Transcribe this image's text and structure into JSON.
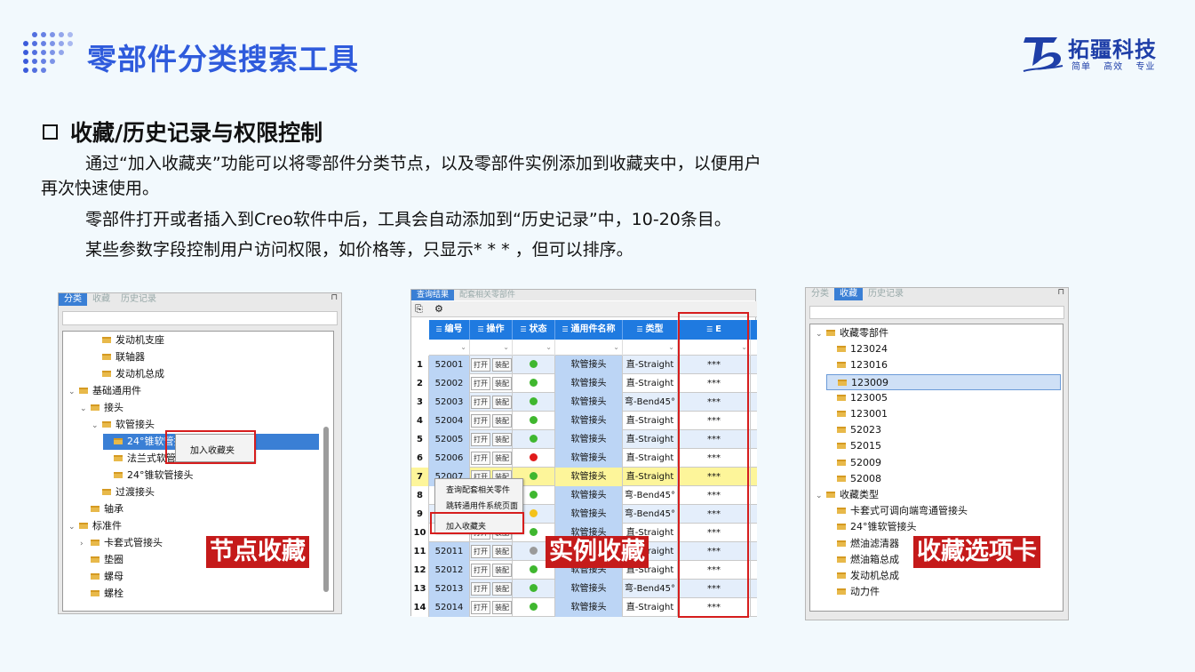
{
  "header": {
    "title": "零部件分类搜索工具",
    "logo_name": "拓疆科技",
    "logo_slogan": "简单 高效 专业"
  },
  "section": {
    "title": "收藏/历史记录与权限控制",
    "para1_line1": "通过“加入收藏夹”功能可以将零部件分类节点，以及零部件实例添加到收藏夹中，以便用户",
    "para1_line2": "再次快速使用。",
    "para2": "零部件打开或者插入到Creo软件中后，工具会自动添加到“历史记录”中，10-20条目。",
    "para3": "某些参数字段控制用户访问权限，如价格等，只显示* * * ，但可以排序。"
  },
  "panel1": {
    "tabs": [
      "分类",
      "收藏",
      "历史记录"
    ],
    "tree": [
      {
        "label": "发动机支座",
        "level": 2,
        "exp": ""
      },
      {
        "label": "联轴器",
        "level": 2,
        "exp": ""
      },
      {
        "label": "发动机总成",
        "level": 2,
        "exp": ""
      },
      {
        "label": "基础通用件",
        "level": 0,
        "exp": "v"
      },
      {
        "label": "接头",
        "level": 1,
        "exp": "v"
      },
      {
        "label": "软管接头",
        "level": 2,
        "exp": "v"
      },
      {
        "label": "24°锥软管接头",
        "level": 3,
        "exp": "",
        "selected": true
      },
      {
        "label": "法兰式软管接头",
        "level": 3,
        "exp": ""
      },
      {
        "label": "24°锥软管接头",
        "level": 3,
        "exp": ""
      },
      {
        "label": "过渡接头",
        "level": 2,
        "exp": ""
      },
      {
        "label": "轴承",
        "level": 1,
        "exp": ""
      },
      {
        "label": "标准件",
        "level": 0,
        "exp": "v"
      },
      {
        "label": "卡套式管接头",
        "level": 1,
        "exp": ">"
      },
      {
        "label": "垫圈",
        "level": 1,
        "exp": ""
      },
      {
        "label": "螺母",
        "level": 1,
        "exp": ""
      },
      {
        "label": "螺栓",
        "level": 1,
        "exp": ""
      }
    ],
    "context_item": "加入收藏夹",
    "badge": "节点收藏"
  },
  "panel2": {
    "tabs": [
      "查询结果",
      "配套相关零部件"
    ],
    "columns": [
      "编号",
      "操作",
      "状态",
      "通用件名称",
      "类型",
      "E"
    ],
    "rows": [
      {
        "n": "1",
        "id": "52001",
        "status": "green",
        "name": "软管接头",
        "type": "直-Straight",
        "e": "***"
      },
      {
        "n": "2",
        "id": "52002",
        "status": "green",
        "name": "软管接头",
        "type": "直-Straight",
        "e": "***"
      },
      {
        "n": "3",
        "id": "52003",
        "status": "green",
        "name": "软管接头",
        "type": "弯-Bend45°",
        "e": "***"
      },
      {
        "n": "4",
        "id": "52004",
        "status": "green",
        "name": "软管接头",
        "type": "直-Straight",
        "e": "***"
      },
      {
        "n": "5",
        "id": "52005",
        "status": "green",
        "name": "软管接头",
        "type": "直-Straight",
        "e": "***"
      },
      {
        "n": "6",
        "id": "52006",
        "status": "red",
        "name": "软管接头",
        "type": "直-Straight",
        "e": "***"
      },
      {
        "n": "7",
        "id": "52007",
        "status": "green",
        "name": "软管接头",
        "type": "直-Straight",
        "e": "***",
        "highlight": true
      },
      {
        "n": "8",
        "id": "",
        "status": "green",
        "name": "软管接头",
        "type": "弯-Bend45°",
        "e": "***"
      },
      {
        "n": "9",
        "id": "",
        "status": "yellow",
        "name": "软管接头",
        "type": "弯-Bend45°",
        "e": "***"
      },
      {
        "n": "10",
        "id": "",
        "status": "green",
        "name": "软管接头",
        "type": "直-Straight",
        "e": "***"
      },
      {
        "n": "11",
        "id": "52011",
        "status": "gray",
        "name": "软管接头",
        "type": "直-Straight",
        "e": "***"
      },
      {
        "n": "12",
        "id": "52012",
        "status": "green",
        "name": "软管接头",
        "type": "直-Straight",
        "e": "***"
      },
      {
        "n": "13",
        "id": "52013",
        "status": "green",
        "name": "软管接头",
        "type": "弯-Bend45°",
        "e": "***"
      },
      {
        "n": "14",
        "id": "52014",
        "status": "green",
        "name": "软管接头",
        "type": "直-Straight",
        "e": "***"
      }
    ],
    "op_open": "打开",
    "op_assemble": "装配",
    "context_items": [
      "查询配套相关零件",
      "跳转通用件系统页面",
      "加入收藏夹"
    ],
    "badge": "实例收藏"
  },
  "panel3": {
    "tabs": [
      "分类",
      "收藏",
      "历史记录"
    ],
    "tree": [
      {
        "label": "收藏零部件",
        "level": 0,
        "exp": "v"
      },
      {
        "label": "123024",
        "level": 1,
        "exp": ""
      },
      {
        "label": "123016",
        "level": 1,
        "exp": ""
      },
      {
        "label": "123009",
        "level": 1,
        "exp": "",
        "selected": true
      },
      {
        "label": "123005",
        "level": 1,
        "exp": ""
      },
      {
        "label": "123001",
        "level": 1,
        "exp": ""
      },
      {
        "label": "52023",
        "level": 1,
        "exp": ""
      },
      {
        "label": "52015",
        "level": 1,
        "exp": ""
      },
      {
        "label": "52009",
        "level": 1,
        "exp": ""
      },
      {
        "label": "52008",
        "level": 1,
        "exp": ""
      },
      {
        "label": "收藏类型",
        "level": 0,
        "exp": "v"
      },
      {
        "label": "卡套式可调向端弯通管接头",
        "level": 1,
        "exp": ""
      },
      {
        "label": "24°锥软管接头",
        "level": 1,
        "exp": ""
      },
      {
        "label": "燃油滤清器",
        "level": 1,
        "exp": ""
      },
      {
        "label": "燃油箱总成",
        "level": 1,
        "exp": ""
      },
      {
        "label": "发动机总成",
        "level": 1,
        "exp": ""
      },
      {
        "label": "动力件",
        "level": 1,
        "exp": ""
      }
    ],
    "badge": "收藏选项卡"
  },
  "colors": {
    "accent": "#2f5bdc",
    "grid_header": "#1f7ae0",
    "row_blue": "#bcd5f5",
    "row_highlight": "#fdf59a",
    "red": "#d61d1d"
  }
}
